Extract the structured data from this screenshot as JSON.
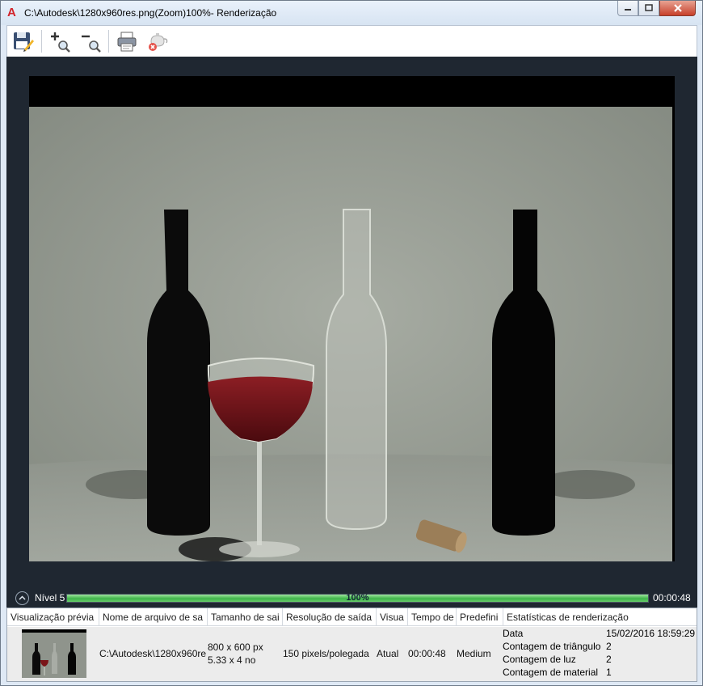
{
  "window": {
    "title": "C:\\Autodesk\\1280x960res.png(Zoom)100%- Renderização",
    "app_icon": "A"
  },
  "toolbar": {
    "icons": [
      "save-icon",
      "zoom-in-icon",
      "zoom-out-icon",
      "print-icon",
      "cancel-render-icon"
    ]
  },
  "status": {
    "level": "Nível 5",
    "progress_text": "100%",
    "progress": 1.0,
    "elapsed": "00:00:48"
  },
  "history": {
    "columns": [
      "Visualização prévia",
      "Nome de arquivo de sa",
      "Tamanho de sai",
      "Resolução de saída",
      "Visua",
      "Tempo de",
      "Predefini",
      "Estatísticas de renderização"
    ],
    "row": {
      "filename": "C:\\Autodesk\\1280x960re",
      "size_px": "800 x 600 px",
      "size_in": "5.33 x 4 no",
      "resolution": "150 pixels/polegada",
      "view": "Atual",
      "time": "00:00:48",
      "preset": "Medium",
      "stats": [
        {
          "key": "Data",
          "value": "15/02/2016 18:59:29"
        },
        {
          "key": "Contagem de triângulo",
          "value": "2"
        },
        {
          "key": "Contagem de luz",
          "value": "2"
        },
        {
          "key": "Contagem de material",
          "value": "1"
        }
      ]
    }
  },
  "colors": {
    "viewer_bg": "#1f2731",
    "progress_green": "#3fb54a",
    "wine": "#6a0f14"
  }
}
